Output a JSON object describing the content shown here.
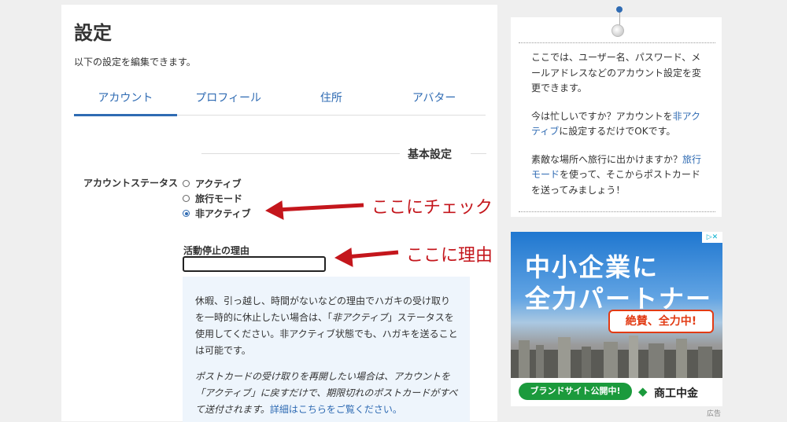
{
  "page": {
    "title": "設定",
    "description": "以下の設定を編集できます。"
  },
  "tabs": [
    {
      "label": "アカウント",
      "active": true
    },
    {
      "label": "プロフィール",
      "active": false
    },
    {
      "label": "住所",
      "active": false
    },
    {
      "label": "アバター",
      "active": false
    }
  ],
  "section": {
    "title": "基本設定",
    "status_label": "アカウントステータス",
    "status_options": [
      {
        "label": "アクティブ",
        "checked": false
      },
      {
        "label": "旅行モード",
        "checked": false
      },
      {
        "label": "非アクティブ",
        "checked": true
      }
    ],
    "reason_label": "活動停止の理由",
    "reason_value": "",
    "info": {
      "p1": "休暇、引っ越し、時間がないなどの理由でハガキの受け取りを一時的に休止したい場合は、「",
      "p1_em": "非アクティブ",
      "p1_end": "」ステータスを使用してください。非アクティブ状態でも、ハガキを送ることは可能です。",
      "p2": "ポストカードの受け取りを再開したい場合は、アカウントを「アクティブ」に戻すだけで、期限切れのポストカードがすべて送付されます。",
      "p2_link": "詳細はこちらをご覧ください。"
    }
  },
  "sidebar": {
    "p1": "ここでは、ユーザー名、パスワード、メールアドレスなどのアカウント設定を変更できます。",
    "p2_a": "今は忙しいですか？アカウントを",
    "p2_link": "非アクティブ",
    "p2_b": "に設定するだけでOKです。",
    "p3_a": "素敵な場所へ旅行に出かけますか？",
    "p3_link": "旅行モード",
    "p3_b": "を使って、そこからポストカードを送ってみましょう！"
  },
  "ad": {
    "line1": "中小企業に",
    "line2": "全力パートナー",
    "badge": "絶賛、全力中!",
    "pill": "ブランドサイト公開中!",
    "brand": "商工中金",
    "caption": "広告"
  },
  "annotations": {
    "check_note": "ここにチェック",
    "reason_note": "ここに理由"
  },
  "colors": {
    "accent": "#2f6bb3",
    "annotation": "#c4161c",
    "info_bg": "#eef5fc"
  }
}
